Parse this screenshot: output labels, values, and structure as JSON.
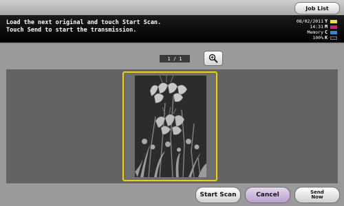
{
  "top_bar": {
    "job_list_label": "Job List"
  },
  "message": {
    "line1": "Load the next original and touch Start Scan.",
    "line2": "Touch Send to start the transmission."
  },
  "status": {
    "date": "08/02/2011",
    "time": "14:31",
    "memory_label": "Memory",
    "memory_value": "100%",
    "toner": [
      {
        "label": "Y",
        "color": "#f2e21a"
      },
      {
        "label": "M",
        "color": "#d6197a"
      },
      {
        "label": "C",
        "color": "#1f8fd6"
      },
      {
        "label": "K",
        "color": "#1a1a1a"
      }
    ]
  },
  "preview": {
    "page_indicator": "1  /  1",
    "zoom_icon": "zoom-in-icon",
    "selection_color": "#f0d400"
  },
  "actions": {
    "start_scan_label": "Start Scan",
    "cancel_label": "Cancel",
    "send_line1": "Send",
    "send_line2": "Now"
  }
}
